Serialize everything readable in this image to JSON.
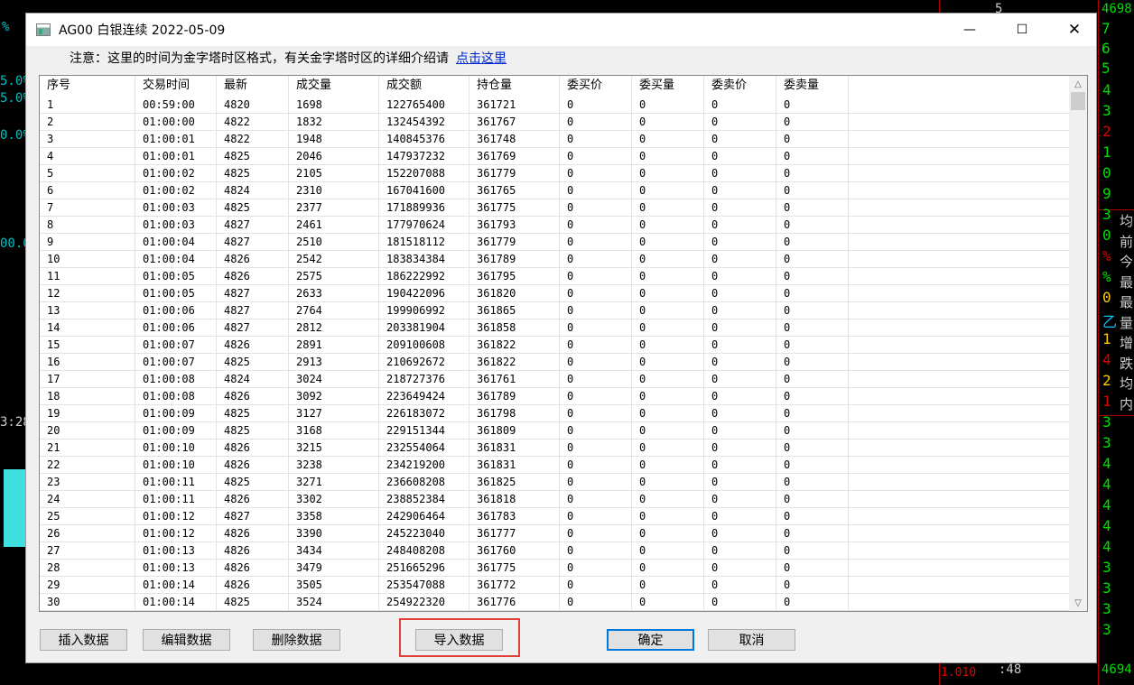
{
  "background": {
    "left_labels": [
      "%",
      "5.0%",
      "5.0%",
      "0.0%",
      "00.0",
      "3:28"
    ],
    "top_right": [
      "5",
      "4698",
      "7",
      "6",
      "5"
    ],
    "right_digits": [
      "4",
      "3",
      "2",
      "1",
      "0",
      "9",
      "3",
      "0",
      "%",
      "%",
      "0",
      "乙",
      "1",
      "4",
      "2",
      "1",
      "3",
      "3",
      "4",
      "4",
      "4",
      "4",
      "4",
      "3",
      "3",
      "3",
      "3"
    ],
    "right_chars": [
      "均",
      "前",
      "今",
      "最",
      "最",
      "量",
      "增",
      "跌",
      "均",
      "内"
    ],
    "bottom_labels": [
      "1.010",
      ":48",
      "4694"
    ]
  },
  "window": {
    "title": "AG00 白银连续 2022-05-09",
    "minimize_label": "—",
    "maximize_label": "☐",
    "close_label": "✕"
  },
  "notice": {
    "text": "注意：这里的时间为金字塔时区格式，有关金字塔时区的详细介绍请",
    "link": "点击这里"
  },
  "table": {
    "headers": [
      "序号",
      "交易时间",
      "最新",
      "成交量",
      "成交额",
      "持仓量",
      "委买价",
      "委买量",
      "委卖价",
      "委卖量",
      ""
    ],
    "rows": [
      [
        "1",
        "00:59:00",
        "4820",
        "1698",
        "122765400",
        "361721",
        "0",
        "0",
        "0",
        "0",
        ""
      ],
      [
        "2",
        "01:00:00",
        "4822",
        "1832",
        "132454392",
        "361767",
        "0",
        "0",
        "0",
        "0",
        ""
      ],
      [
        "3",
        "01:00:01",
        "4822",
        "1948",
        "140845376",
        "361748",
        "0",
        "0",
        "0",
        "0",
        ""
      ],
      [
        "4",
        "01:00:01",
        "4825",
        "2046",
        "147937232",
        "361769",
        "0",
        "0",
        "0",
        "0",
        ""
      ],
      [
        "5",
        "01:00:02",
        "4825",
        "2105",
        "152207088",
        "361779",
        "0",
        "0",
        "0",
        "0",
        ""
      ],
      [
        "6",
        "01:00:02",
        "4824",
        "2310",
        "167041600",
        "361765",
        "0",
        "0",
        "0",
        "0",
        ""
      ],
      [
        "7",
        "01:00:03",
        "4825",
        "2377",
        "171889936",
        "361775",
        "0",
        "0",
        "0",
        "0",
        ""
      ],
      [
        "8",
        "01:00:03",
        "4827",
        "2461",
        "177970624",
        "361793",
        "0",
        "0",
        "0",
        "0",
        ""
      ],
      [
        "9",
        "01:00:04",
        "4827",
        "2510",
        "181518112",
        "361779",
        "0",
        "0",
        "0",
        "0",
        ""
      ],
      [
        "10",
        "01:00:04",
        "4826",
        "2542",
        "183834384",
        "361789",
        "0",
        "0",
        "0",
        "0",
        ""
      ],
      [
        "11",
        "01:00:05",
        "4826",
        "2575",
        "186222992",
        "361795",
        "0",
        "0",
        "0",
        "0",
        ""
      ],
      [
        "12",
        "01:00:05",
        "4827",
        "2633",
        "190422096",
        "361820",
        "0",
        "0",
        "0",
        "0",
        ""
      ],
      [
        "13",
        "01:00:06",
        "4827",
        "2764",
        "199906992",
        "361865",
        "0",
        "0",
        "0",
        "0",
        ""
      ],
      [
        "14",
        "01:00:06",
        "4827",
        "2812",
        "203381904",
        "361858",
        "0",
        "0",
        "0",
        "0",
        ""
      ],
      [
        "15",
        "01:00:07",
        "4826",
        "2891",
        "209100608",
        "361822",
        "0",
        "0",
        "0",
        "0",
        ""
      ],
      [
        "16",
        "01:00:07",
        "4825",
        "2913",
        "210692672",
        "361822",
        "0",
        "0",
        "0",
        "0",
        ""
      ],
      [
        "17",
        "01:00:08",
        "4824",
        "3024",
        "218727376",
        "361761",
        "0",
        "0",
        "0",
        "0",
        ""
      ],
      [
        "18",
        "01:00:08",
        "4826",
        "3092",
        "223649424",
        "361789",
        "0",
        "0",
        "0",
        "0",
        ""
      ],
      [
        "19",
        "01:00:09",
        "4825",
        "3127",
        "226183072",
        "361798",
        "0",
        "0",
        "0",
        "0",
        ""
      ],
      [
        "20",
        "01:00:09",
        "4825",
        "3168",
        "229151344",
        "361809",
        "0",
        "0",
        "0",
        "0",
        ""
      ],
      [
        "21",
        "01:00:10",
        "4826",
        "3215",
        "232554064",
        "361831",
        "0",
        "0",
        "0",
        "0",
        ""
      ],
      [
        "22",
        "01:00:10",
        "4826",
        "3238",
        "234219200",
        "361831",
        "0",
        "0",
        "0",
        "0",
        ""
      ],
      [
        "23",
        "01:00:11",
        "4825",
        "3271",
        "236608208",
        "361825",
        "0",
        "0",
        "0",
        "0",
        ""
      ],
      [
        "24",
        "01:00:11",
        "4826",
        "3302",
        "238852384",
        "361818",
        "0",
        "0",
        "0",
        "0",
        ""
      ],
      [
        "25",
        "01:00:12",
        "4827",
        "3358",
        "242906464",
        "361783",
        "0",
        "0",
        "0",
        "0",
        ""
      ],
      [
        "26",
        "01:00:12",
        "4826",
        "3390",
        "245223040",
        "361777",
        "0",
        "0",
        "0",
        "0",
        ""
      ],
      [
        "27",
        "01:00:13",
        "4826",
        "3434",
        "248408208",
        "361760",
        "0",
        "0",
        "0",
        "0",
        ""
      ],
      [
        "28",
        "01:00:13",
        "4826",
        "3479",
        "251665296",
        "361775",
        "0",
        "0",
        "0",
        "0",
        ""
      ],
      [
        "29",
        "01:00:14",
        "4826",
        "3505",
        "253547088",
        "361772",
        "0",
        "0",
        "0",
        "0",
        ""
      ],
      [
        "30",
        "01:00:14",
        "4825",
        "3524",
        "254922320",
        "361776",
        "0",
        "0",
        "0",
        "0",
        ""
      ]
    ]
  },
  "buttons": {
    "insert": "插入数据",
    "edit": "编辑数据",
    "delete": "删除数据",
    "import": "导入数据",
    "ok": "确定",
    "cancel": "取消"
  },
  "colors": {
    "highlight": "#e0403a",
    "link": "#0026d4",
    "default_button_border": "#0078d7"
  }
}
